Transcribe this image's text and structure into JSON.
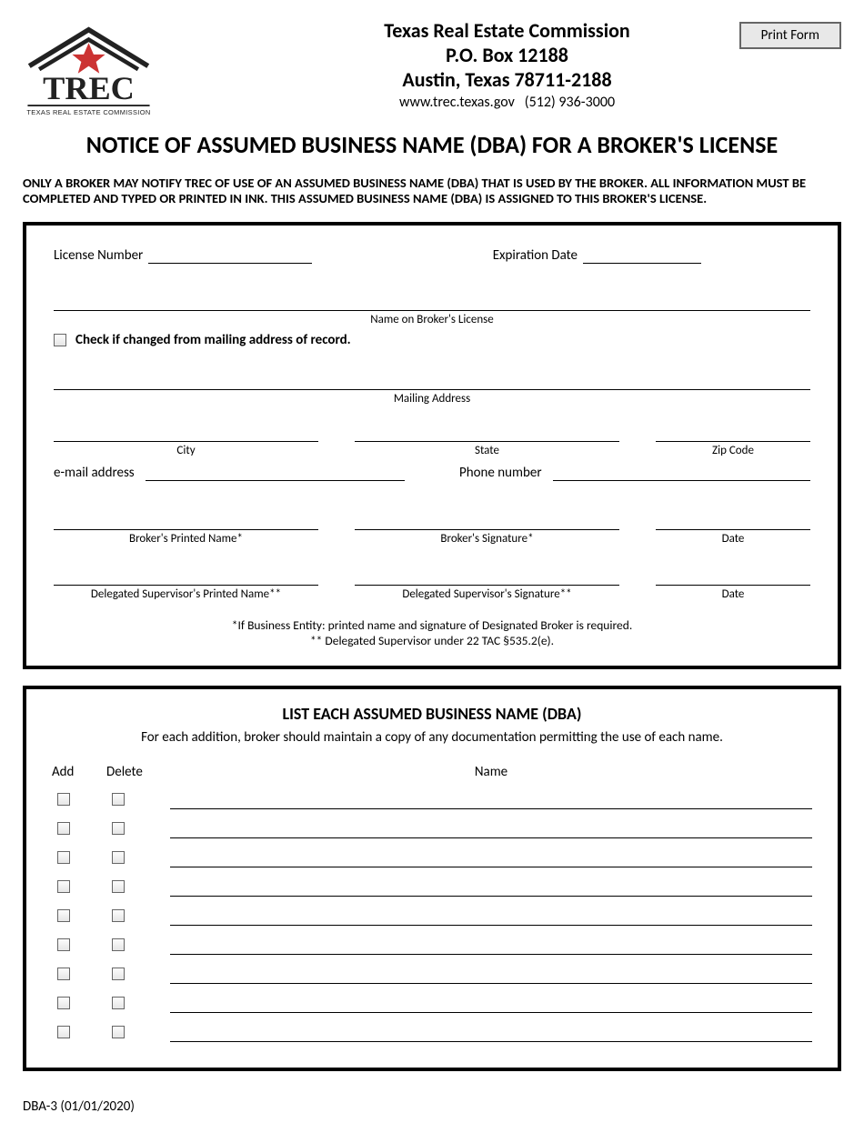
{
  "logo": {
    "alt": "TREC — Texas Real Estate Commission"
  },
  "header": {
    "org": "Texas Real Estate Commission",
    "pobox": "P.O. Box 12188",
    "citystatezip": "Austin, Texas 78711-2188",
    "website": "www.trec.texas.gov",
    "phone": "(512) 936-3000"
  },
  "print_button": "Print Form",
  "title": "NOTICE OF ASSUMED BUSINESS NAME (DBA) FOR A BROKER'S LICENSE",
  "instructions": "ONLY A BROKER MAY NOTIFY TREC OF USE OF AN ASSUMED BUSINESS NAME (DBA) THAT IS USED BY THE BROKER. ALL INFORMATION MUST BE COMPLETED AND TYPED OR PRINTED IN INK. THIS ASSUMED BUSINESS NAME (DBA) IS ASSIGNED TO THIS BROKER'S LICENSE.",
  "fields": {
    "license_number_label": "License Number",
    "expiration_date_label": "Expiration Date",
    "name_on_license_caption": "Name on Broker's License",
    "checkbox_changed_label": "Check if changed from mailing address of record.",
    "mailing_address_caption": "Mailing Address",
    "city_caption": "City",
    "state_caption": "State",
    "zip_caption": "Zip Code",
    "email_label": "e-mail address",
    "phone_label": "Phone number",
    "broker_printed_caption": "Broker's Printed Name*",
    "broker_sig_caption": "Broker's Signature*",
    "date_caption": "Date",
    "supervisor_printed_caption": "Delegated Supervisor's Printed Name**",
    "supervisor_sig_caption": "Delegated Supervisor's Signature**"
  },
  "footnote1": "*If Business Entity: printed name and signature of Designated Broker is required.",
  "footnote2": "** Delegated Supervisor under 22 TAC §535.2(e).",
  "dba": {
    "title": "LIST EACH ASSUMED BUSINESS NAME (DBA)",
    "subtitle": "For each addition, broker should maintain a copy of any documentation permitting the use of each name.",
    "col_add": "Add",
    "col_delete": "Delete",
    "col_name": "Name",
    "row_count": 9
  },
  "form_id": "DBA-3 (01/01/2020)"
}
